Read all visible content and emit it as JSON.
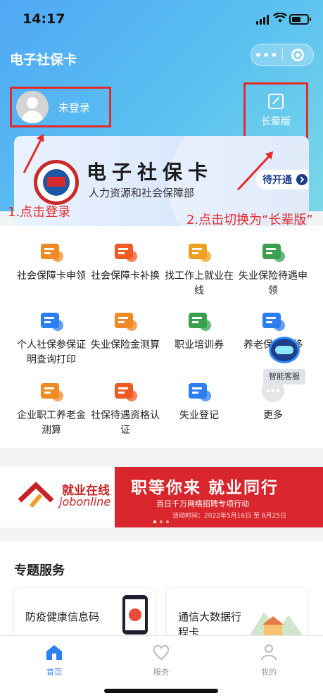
{
  "status": {
    "time": "14:17"
  },
  "header": {
    "title": "电子社保卡",
    "more_label": "•••"
  },
  "login": {
    "label": "未登录"
  },
  "elder": {
    "label": "长辈版"
  },
  "card": {
    "title": "电子社保卡",
    "subtitle": "人力资源和社会保障部",
    "activate_label": "待开通"
  },
  "annotations": {
    "step1": "1.点击登录",
    "step2": "2.点击切换为“长辈版”"
  },
  "services": [
    {
      "label": "社会保障卡申领",
      "icon": "card-apply-icon",
      "color": "#f08a24"
    },
    {
      "label": "社会保障卡补换",
      "icon": "card-replace-icon",
      "color": "#f05a24"
    },
    {
      "label": "找工作上就业在线",
      "icon": "job-search-icon",
      "color": "#f0a020"
    },
    {
      "label": "失业保险待遇申领",
      "icon": "unemployment-benefit-icon",
      "color": "#3aa050"
    },
    {
      "label": "个人社保参保证明查询打印",
      "icon": "certificate-print-icon",
      "color": "#2d7ef0"
    },
    {
      "label": "失业保险金测算",
      "icon": "calculator-icon",
      "color": "#f08a24"
    },
    {
      "label": "职业培训券",
      "icon": "training-voucher-icon",
      "color": "#3aa050"
    },
    {
      "label": "养老保险转移",
      "icon": "pension-transfer-icon",
      "color": "#2d7ef0"
    },
    {
      "label": "企业职工养老金测算",
      "icon": "pension-calc-icon",
      "color": "#f08a24"
    },
    {
      "label": "社保待遇资格认证",
      "icon": "qualification-icon",
      "color": "#f05a24"
    },
    {
      "label": "失业登记",
      "icon": "unemployment-register-icon",
      "color": "#2d7ef0"
    },
    {
      "label": "更多",
      "icon": "more-icon",
      "color": "#d8d8d8"
    }
  ],
  "service_label": {
    "kefu": "智能客服"
  },
  "banner": {
    "brand_cn": "就业在线",
    "brand_en": "jobonline",
    "main": "职等你来 就业同行",
    "sub": "百日千万网络招聘专项行动",
    "date": "活动时间：2022年5月16日 至 8月25日"
  },
  "special": {
    "title": "专题服务",
    "cards": [
      "防疫健康信息码",
      "通信大数据行程卡"
    ]
  },
  "tabs": [
    {
      "label": "首页",
      "active": true
    },
    {
      "label": "服务",
      "active": false
    },
    {
      "label": "我的",
      "active": false
    }
  ]
}
